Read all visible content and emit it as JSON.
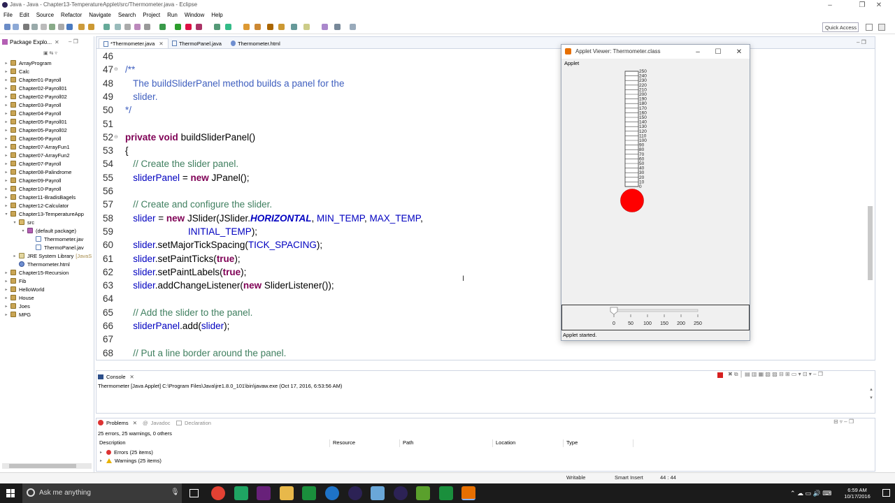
{
  "window": {
    "title": "Java - Java - Chapter13-TemperatureApplet/src/Thermometer.java - Eclipse"
  },
  "menu": [
    "File",
    "Edit",
    "Source",
    "Refactor",
    "Navigate",
    "Search",
    "Project",
    "Run",
    "Window",
    "Help"
  ],
  "toolbar": {
    "quick_access": "Quick Access"
  },
  "package_explorer": {
    "title": "Package Explo...",
    "items": [
      {
        "label": "ArrayProgram",
        "level": 0,
        "kind": "project"
      },
      {
        "label": "Calc",
        "level": 0,
        "kind": "project"
      },
      {
        "label": "Chapter01-Payroll",
        "level": 0,
        "kind": "project"
      },
      {
        "label": "Chapter02-Payroll01",
        "level": 0,
        "kind": "project"
      },
      {
        "label": "Chapter02-Payroll02",
        "level": 0,
        "kind": "project"
      },
      {
        "label": "Chapter03-Payroll",
        "level": 0,
        "kind": "project"
      },
      {
        "label": "Chapter04-Payroll",
        "level": 0,
        "kind": "project"
      },
      {
        "label": "Chapter05-Payroll01",
        "level": 0,
        "kind": "project"
      },
      {
        "label": "Chapter05-Payroll02",
        "level": 0,
        "kind": "project"
      },
      {
        "label": "Chapter06-Payroll",
        "level": 0,
        "kind": "project"
      },
      {
        "label": "Chapter07-ArrayFun1",
        "level": 0,
        "kind": "project"
      },
      {
        "label": "Chapter07-ArrayFun2",
        "level": 0,
        "kind": "project"
      },
      {
        "label": "Chapter07-Payroll",
        "level": 0,
        "kind": "project"
      },
      {
        "label": "Chapter08-Palindrome",
        "level": 0,
        "kind": "project"
      },
      {
        "label": "Chapter09-Payroll",
        "level": 0,
        "kind": "project"
      },
      {
        "label": "Chapter10-Payroll",
        "level": 0,
        "kind": "project"
      },
      {
        "label": "Chapter11-BradisBagels",
        "level": 0,
        "kind": "project"
      },
      {
        "label": "Chapter12-Calculator",
        "level": 0,
        "kind": "project"
      },
      {
        "label": "Chapter13-TemperatureApp",
        "level": 0,
        "kind": "project",
        "expanded": true
      },
      {
        "label": "src",
        "level": 1,
        "kind": "folder",
        "expanded": true
      },
      {
        "label": "(default package)",
        "level": 2,
        "kind": "package",
        "expanded": true
      },
      {
        "label": "Thermometer.jav",
        "level": 3,
        "kind": "java"
      },
      {
        "label": "ThermoPanel.jav",
        "level": 3,
        "kind": "java"
      },
      {
        "label": "JRE System Library",
        "suffix": "[JavaS",
        "level": 1,
        "kind": "lib"
      },
      {
        "label": "Thermometer.html",
        "level": 1,
        "kind": "html"
      },
      {
        "label": "Chapter15-Recursion",
        "level": 0,
        "kind": "project"
      },
      {
        "label": "Fib",
        "level": 0,
        "kind": "project"
      },
      {
        "label": "HelloWorld",
        "level": 0,
        "kind": "project"
      },
      {
        "label": "House",
        "level": 0,
        "kind": "project"
      },
      {
        "label": "Joes",
        "level": 0,
        "kind": "project"
      },
      {
        "label": "MPG",
        "level": 0,
        "kind": "project"
      }
    ]
  },
  "editor": {
    "tabs": [
      "*Thermometer.java",
      "ThermoPanel.java",
      "Thermometer.html"
    ],
    "lines": [
      {
        "n": "46",
        "segs": []
      },
      {
        "n": "47",
        "fold": true,
        "segs": [
          {
            "t": "/**",
            "c": "cm"
          }
        ]
      },
      {
        "n": "48",
        "segs": [
          {
            "t": "   The buildSliderPanel method builds a panel for the",
            "c": "cm"
          }
        ]
      },
      {
        "n": "49",
        "segs": [
          {
            "t": "   slider.",
            "c": "cm"
          }
        ]
      },
      {
        "n": "50",
        "segs": [
          {
            "t": "*/",
            "c": "cm"
          }
        ]
      },
      {
        "n": "51",
        "segs": []
      },
      {
        "n": "52",
        "fold": true,
        "segs": [
          {
            "t": "private",
            "c": "kw"
          },
          {
            "t": " ",
            "c": ""
          },
          {
            "t": "void",
            "c": "kw"
          },
          {
            "t": " buildSliderPanel()",
            "c": ""
          }
        ]
      },
      {
        "n": "53",
        "segs": [
          {
            "t": "{",
            "c": ""
          }
        ]
      },
      {
        "n": "54",
        "segs": [
          {
            "t": "   // Create the slider panel.",
            "c": "cg"
          }
        ]
      },
      {
        "n": "55",
        "segs": [
          {
            "t": "   ",
            "c": ""
          },
          {
            "t": "sliderPanel",
            "c": "fd"
          },
          {
            "t": " = ",
            "c": ""
          },
          {
            "t": "new",
            "c": "kw"
          },
          {
            "t": " JPanel();",
            "c": ""
          }
        ]
      },
      {
        "n": "56",
        "segs": []
      },
      {
        "n": "57",
        "segs": [
          {
            "t": "   // Create and configure the slider.",
            "c": "cg"
          }
        ]
      },
      {
        "n": "58",
        "segs": [
          {
            "t": "   ",
            "c": ""
          },
          {
            "t": "slider",
            "c": "fd"
          },
          {
            "t": " = ",
            "c": ""
          },
          {
            "t": "new",
            "c": "kw"
          },
          {
            "t": " JSlider(JSlider.",
            "c": ""
          },
          {
            "t": "HORIZONTAL",
            "c": "fdi"
          },
          {
            "t": ", ",
            "c": ""
          },
          {
            "t": "MIN_TEMP",
            "c": "fd"
          },
          {
            "t": ", ",
            "c": ""
          },
          {
            "t": "MAX_TEMP",
            "c": "fd"
          },
          {
            "t": ",",
            "c": ""
          }
        ]
      },
      {
        "n": "59",
        "segs": [
          {
            "t": "                        ",
            "c": ""
          },
          {
            "t": "INITIAL_TEMP",
            "c": "fd"
          },
          {
            "t": ");",
            "c": ""
          }
        ]
      },
      {
        "n": "60",
        "segs": [
          {
            "t": "   ",
            "c": ""
          },
          {
            "t": "slider",
            "c": "fd"
          },
          {
            "t": ".setMajorTickSpacing(",
            "c": ""
          },
          {
            "t": "TICK_SPACING",
            "c": "fd"
          },
          {
            "t": ");",
            "c": ""
          }
        ]
      },
      {
        "n": "61",
        "segs": [
          {
            "t": "   ",
            "c": ""
          },
          {
            "t": "slider",
            "c": "fd"
          },
          {
            "t": ".setPaintTicks(",
            "c": ""
          },
          {
            "t": "true",
            "c": "kw"
          },
          {
            "t": ");",
            "c": ""
          }
        ]
      },
      {
        "n": "62",
        "segs": [
          {
            "t": "   ",
            "c": ""
          },
          {
            "t": "slider",
            "c": "fd"
          },
          {
            "t": ".setPaintLabels(",
            "c": ""
          },
          {
            "t": "true",
            "c": "kw"
          },
          {
            "t": ");",
            "c": ""
          }
        ]
      },
      {
        "n": "63",
        "segs": [
          {
            "t": "   ",
            "c": ""
          },
          {
            "t": "slider",
            "c": "fd"
          },
          {
            "t": ".addChangeListener(",
            "c": ""
          },
          {
            "t": "new",
            "c": "kw"
          },
          {
            "t": " SliderListener());",
            "c": ""
          }
        ]
      },
      {
        "n": "64",
        "segs": []
      },
      {
        "n": "65",
        "segs": [
          {
            "t": "   // Add the slider to the panel.",
            "c": "cg"
          }
        ]
      },
      {
        "n": "66",
        "segs": [
          {
            "t": "   ",
            "c": ""
          },
          {
            "t": "sliderPanel",
            "c": "fd"
          },
          {
            "t": ".add(",
            "c": ""
          },
          {
            "t": "slider",
            "c": "fd"
          },
          {
            "t": ");",
            "c": ""
          }
        ]
      },
      {
        "n": "67",
        "segs": []
      },
      {
        "n": "68",
        "segs": [
          {
            "t": "   // Put a line border around the panel.",
            "c": "cg"
          }
        ]
      }
    ]
  },
  "console": {
    "tab": "Console",
    "launch": "Thermometer [Java Applet] C:\\Program Files\\Java\\jre1.8.0_101\\bin\\javaw.exe (Oct 17, 2016, 6:53:56 AM)"
  },
  "problems": {
    "tabs": [
      "Problems",
      "Javadoc",
      "Declaration"
    ],
    "summary": "25 errors, 25 warnings, 0 others",
    "columns": [
      "Description",
      "Resource",
      "Path",
      "Location",
      "Type"
    ],
    "rows": [
      "Errors (25 items)",
      "Warnings (25 items)"
    ]
  },
  "status": {
    "writable": "Writable",
    "insert": "Smart Insert",
    "position": "44 : 44"
  },
  "applet": {
    "title": "Applet Viewer: Thermometer.class",
    "menu": "Applet",
    "status": "Applet started.",
    "scale_labels": [
      "250",
      "240",
      "230",
      "220",
      "210",
      "200",
      "190",
      "180",
      "170",
      "160",
      "150",
      "140",
      "130",
      "120",
      "110",
      "100",
      "90",
      "80",
      "70",
      "60",
      "50",
      "40",
      "30",
      "20",
      "10",
      "0"
    ],
    "slider_labels": [
      "0",
      "50",
      "100",
      "150",
      "200",
      "250"
    ],
    "slider_min": 0,
    "slider_max": 250,
    "slider_value": 0,
    "bulb_color": "#ff0000"
  },
  "taskbar": {
    "search": "Ask me anything",
    "time": "6:59 AM",
    "date": "10/17/2016"
  }
}
